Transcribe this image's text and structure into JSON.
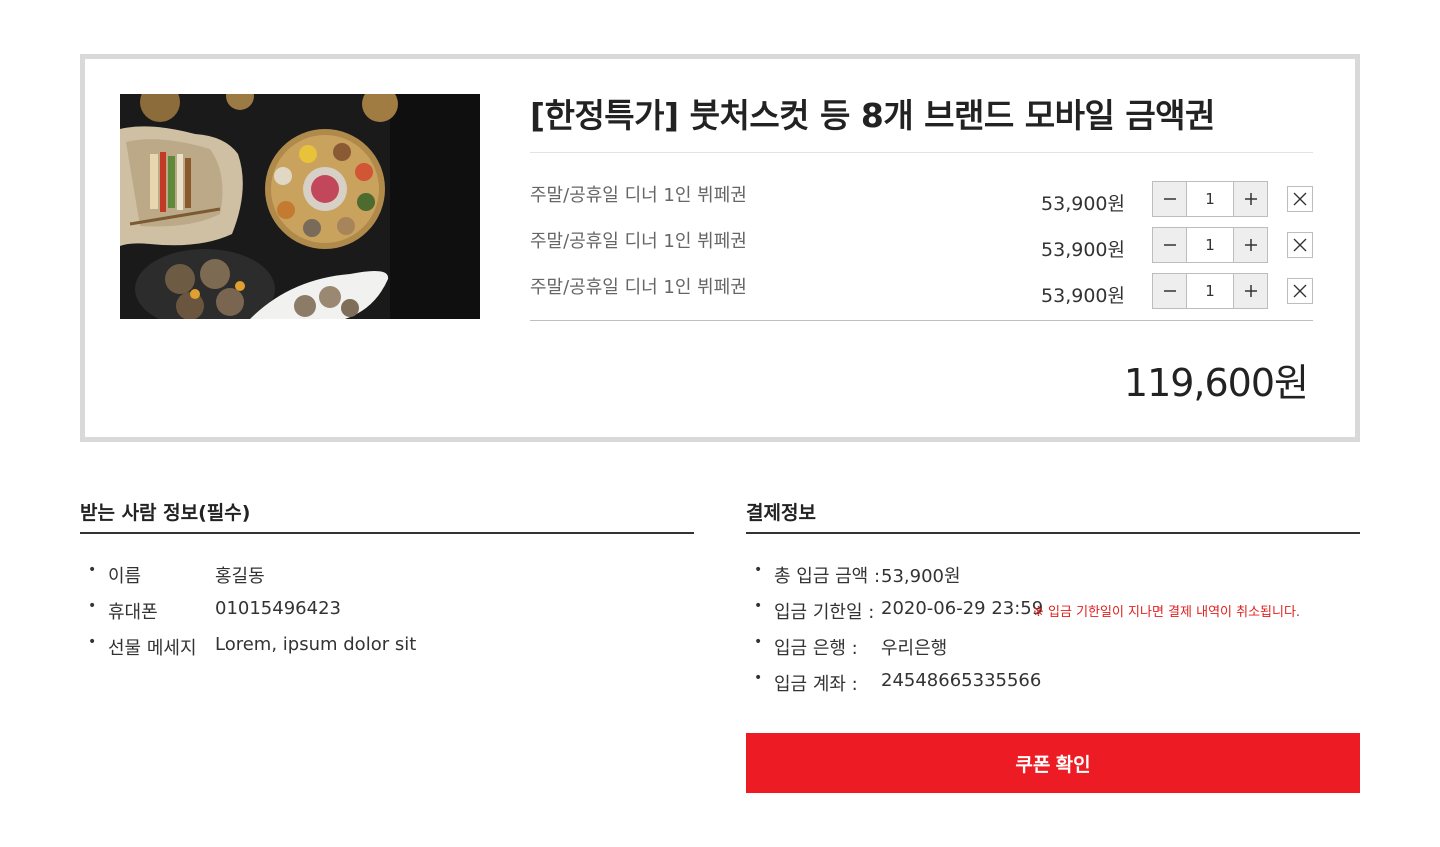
{
  "product": {
    "title": "[한정특가] 붓처스컷 등 8개 브랜드 모바일 금액권",
    "options": [
      {
        "name": "주말/공휴일 디너 1인 뷔페권",
        "price": "53,900원",
        "quantity": "1"
      },
      {
        "name": "주말/공휴일 디너 1인 뷔페권",
        "price": "53,900원",
        "quantity": "1"
      },
      {
        "name": "주말/공휴일 디너 1인 뷔페권",
        "price": "53,900원",
        "quantity": "1"
      }
    ],
    "total": "119,600원",
    "icons": {
      "decrease": "minus-icon",
      "increase": "plus-icon",
      "remove": "close-icon"
    }
  },
  "recipient": {
    "title": "받는 사람 정보(필수)",
    "rows": [
      {
        "bullet": "•",
        "label": "이름",
        "value": "홍길동"
      },
      {
        "bullet": "•",
        "label": "휴대폰",
        "value": "01015496423"
      },
      {
        "bullet": "•",
        "label": "선물 메세지",
        "value": "Lorem, ipsum dolor sit"
      }
    ]
  },
  "payment": {
    "title": "결제정보",
    "rows": [
      {
        "bullet": "•",
        "label": "총 입금 금액 :",
        "value": "53,900원"
      },
      {
        "bullet": "•",
        "label": "입금 기한일 :",
        "value": "2020-06-29 23:59",
        "notice": "※ 입금 기한일이 지나면 결제 내역이 취소됩니다."
      },
      {
        "bullet": "•",
        "label": "입금 은행 :",
        "value": "우리은행"
      },
      {
        "bullet": "•",
        "label": "입금 계좌 :",
        "value": "24548665335566"
      }
    ]
  },
  "coupon_button": {
    "label": "쿠폰 확인"
  },
  "colors": {
    "accent": "#ed1c24",
    "notice": "#e02020",
    "box_border": "#d9d9d9"
  }
}
